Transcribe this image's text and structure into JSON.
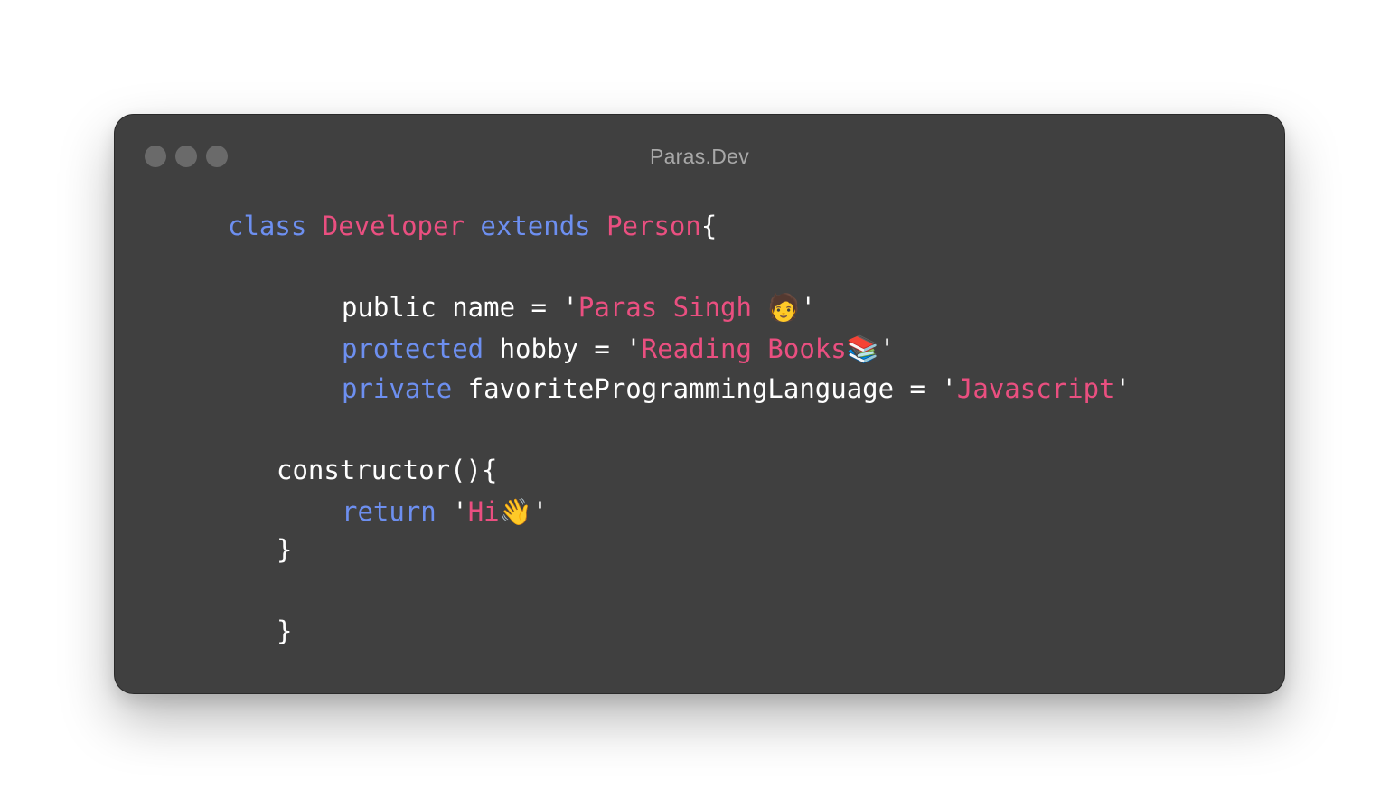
{
  "window": {
    "title": "Paras.Dev"
  },
  "colors": {
    "background": "#404040",
    "keyword": "#6d8ff0",
    "type": "#ea4f80",
    "string": "#ea4f80",
    "text": "#ffffff",
    "title": "#a8a8a8",
    "window_dots": "#6a6a6a"
  },
  "code": {
    "line1": {
      "kw_class": "class",
      "type_name": "Developer",
      "kw_extends": "extends",
      "parent_type": "Person",
      "brace": "{"
    },
    "line2": {
      "text": "public name = '",
      "value": "Paras Singh 🧑",
      "close": "'"
    },
    "line3": {
      "kw": "protected",
      "text": " hobby = '",
      "value": "Reading Books📚",
      "close": "'"
    },
    "line4": {
      "kw": "private",
      "text": " favoriteProgrammingLanguage = '",
      "value": "Javascript",
      "close": "'"
    },
    "line5": {
      "text": "constructor(){"
    },
    "line6": {
      "kw": "return",
      "text": " '",
      "value": "Hi👋",
      "close": "'"
    },
    "line7": {
      "text": "}"
    },
    "line8": {
      "text": "}"
    }
  }
}
